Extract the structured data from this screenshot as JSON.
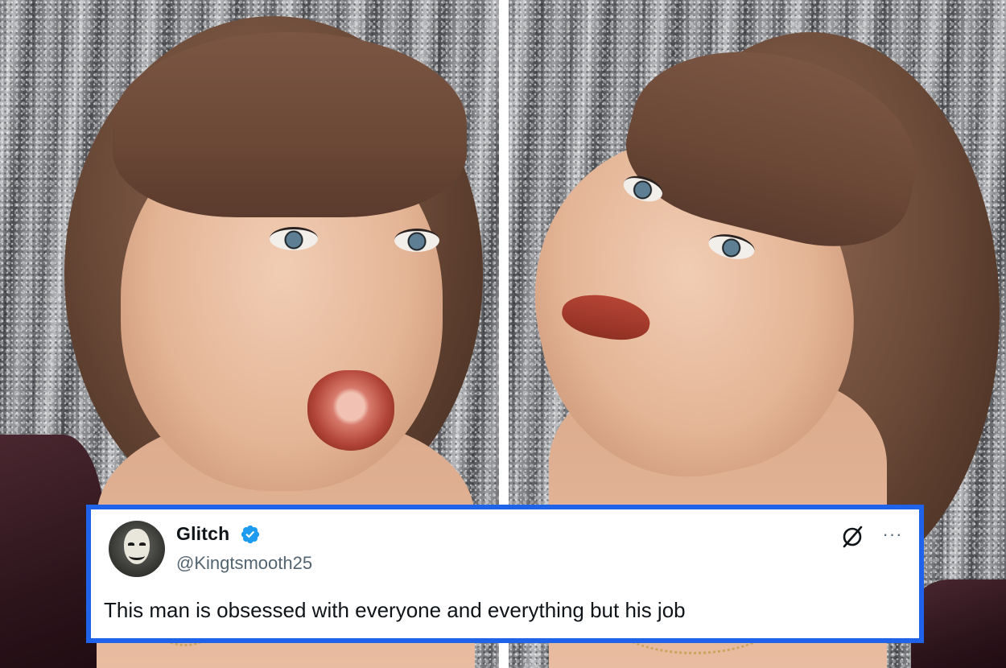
{
  "tweet": {
    "display_name": "Glitch",
    "handle": "@Kingtsmooth25",
    "text": "This man is obsessed with everyone and everything but his job",
    "verified": true,
    "avatar_icon": "masked-avatar-icon",
    "actions_icons": [
      "grok-icon",
      "more-options-icon"
    ],
    "more_label": "···"
  },
  "colors": {
    "card_border": "#1e63e9",
    "verified_badge": "#1d9bf0",
    "handle_text": "#536471",
    "body_text": "#0f1419"
  },
  "photos": {
    "left_icon": "photo-surprised-expression",
    "right_icon": "photo-smirking-expression"
  }
}
